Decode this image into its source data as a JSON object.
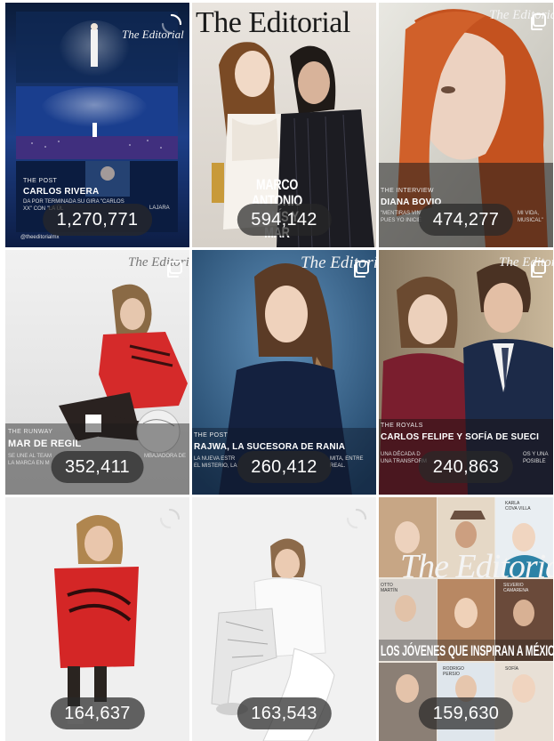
{
  "grid": {
    "posts": [
      {
        "id": "post-1",
        "magazine": "The Editorial",
        "kicker": "THE POST",
        "headline": "CARLOS RIVERA",
        "dek": "DA POR TERMINADA SU GIRA \"CARLOS XX\" CON \"LA ÚL",
        "dek_tail": "LAJARA",
        "handle": "@theeditorialmx",
        "count": "1,270,771",
        "type": "multi"
      },
      {
        "id": "post-2",
        "magazine": "The Editorial",
        "headline": "MARCO ANTONIO SOLÍS Y MAR",
        "count": "594,142",
        "type": "image"
      },
      {
        "id": "post-3",
        "magazine": "The Editorial",
        "kicker": "THE INTERVIEW",
        "headline": "DIANA BOVIO",
        "dek": "\"MENTIRAS VIN",
        "dek2": "PUES YO INICIÉ",
        "dek_tail": "MI VIDA,",
        "dek_tail2": "MUSICAL\"",
        "count": "474,277",
        "type": "multi"
      },
      {
        "id": "post-4",
        "magazine": "The Editorial",
        "kicker": "THE RUNWAY",
        "headline": "MAR DE REGIL",
        "dek": "SE UNE AL TEAM",
        "dek2": "LA MARCA EN M",
        "dek_tail": "MBAJADORA DE",
        "count": "352,411",
        "type": "multi"
      },
      {
        "id": "post-5",
        "magazine": "The Editorial",
        "kicker": "THE POST",
        "headline": "RAJWA, LA SUCESORA DE RANIA",
        "dek": "LA NUEVA ESTR",
        "dek2": "EL MISTERIO, LA",
        "dek_tail": "MITA, ENTRE",
        "dek_tail2": "REAL.",
        "count": "260,412",
        "type": "multi"
      },
      {
        "id": "post-6",
        "magazine": "The Editorial",
        "kicker": "THE ROYALS",
        "headline": "CARLOS FELIPE Y SOFÍA DE SUECI",
        "dek": "UNA DÉCADA D",
        "dek2": "UNA TRANSFORM",
        "dek_tail": "OS Y UNA",
        "dek_tail2": "POSIBLE",
        "count": "240,863",
        "type": "multi"
      },
      {
        "id": "post-7",
        "count": "164,637",
        "type": "reel"
      },
      {
        "id": "post-8",
        "count": "163,543",
        "type": "reel"
      },
      {
        "id": "post-9",
        "magazine": "The Editorial",
        "headline": "LOS JÓVENES QUE INSPIRAN A MÉXICO",
        "names": [
          "KARLA",
          "COVA VILLA",
          "OTTO",
          "MARTÍN",
          "SILVERIO",
          "CAMARENA",
          "RODRIGO",
          "PERSIO",
          "SOFÍA"
        ],
        "count": "159,630",
        "type": "image"
      }
    ]
  },
  "colors": {
    "pill_bg": "rgba(40,40,40,0.72)",
    "pill_text": "#ffffff"
  },
  "icons": {
    "multi": "multi-post-icon",
    "reel": "reel-icon"
  }
}
